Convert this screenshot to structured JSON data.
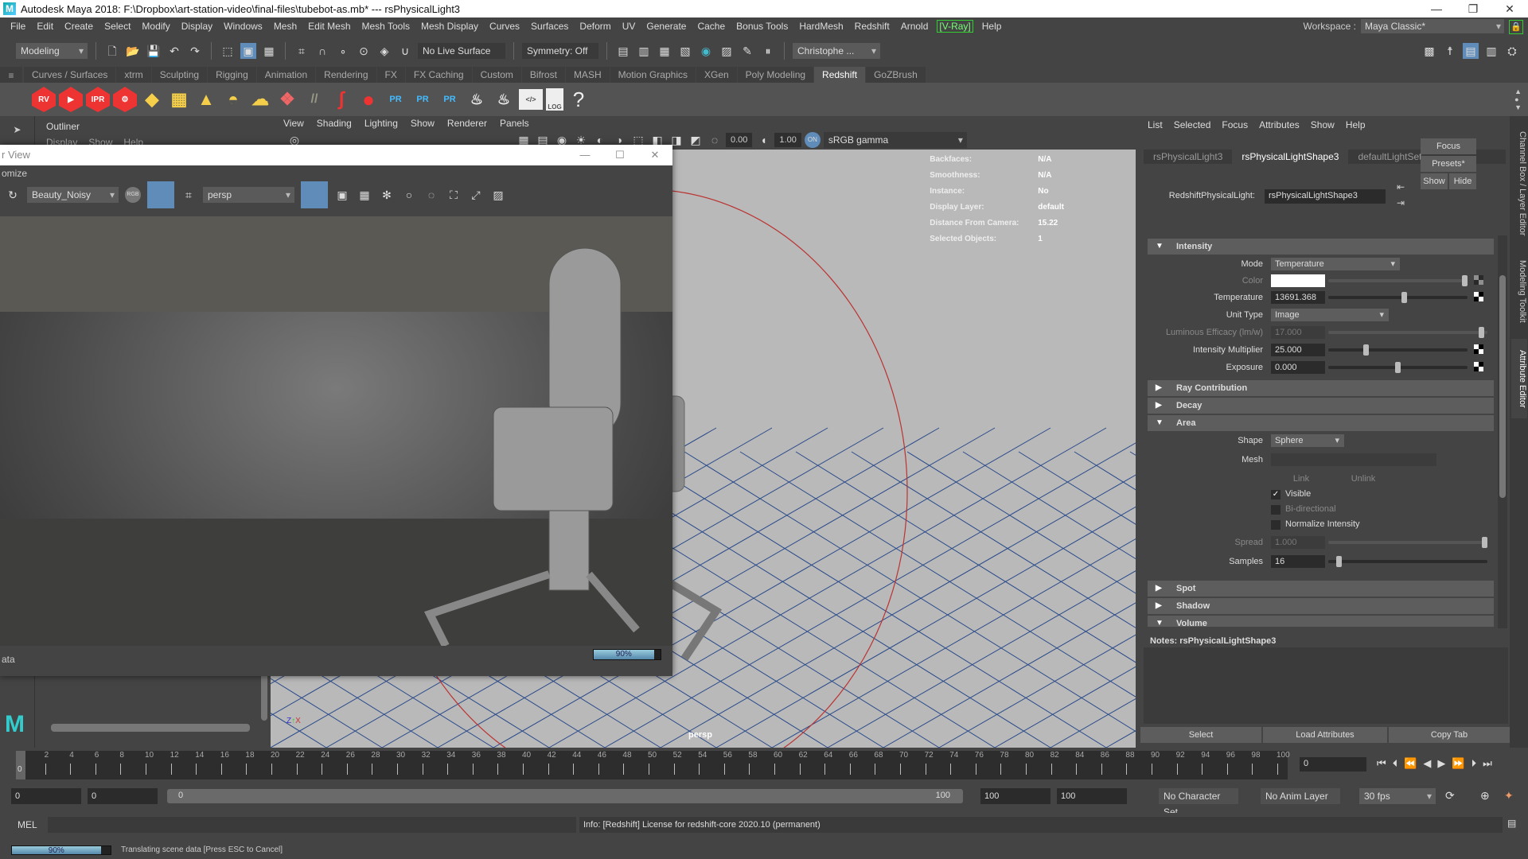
{
  "window": {
    "title": "Autodesk Maya 2018: F:\\Dropbox\\art-station-video\\final-files\\tubebot-as.mb*  ---  rsPhysicalLight3",
    "controls": [
      "—",
      "❐",
      "✕"
    ]
  },
  "menubar": [
    "File",
    "Edit",
    "Create",
    "Select",
    "Modify",
    "Display",
    "Windows",
    "Mesh",
    "Edit Mesh",
    "Mesh Tools",
    "Mesh Display",
    "Curves",
    "Surfaces",
    "Deform",
    "UV",
    "Generate",
    "Cache",
    "Bonus Tools",
    "HardMesh",
    "Redshift",
    "Arnold",
    "[V-Ray]",
    "Help"
  ],
  "workspace": {
    "label": "Workspace :",
    "value": "Maya Classic*"
  },
  "statusline": {
    "mode": "Modeling",
    "live_surface": "No Live Surface",
    "symmetry": "Symmetry: Off",
    "user": "Christophe ..."
  },
  "shelf": {
    "tabs": [
      "Curves / Surfaces",
      "xtrm",
      "Sculpting",
      "Rigging",
      "Animation",
      "Rendering",
      "FX",
      "FX Caching",
      "Custom",
      "Bifrost",
      "MASH",
      "Motion Graphics",
      "XGen",
      "Poly Modeling",
      "Redshift",
      "GoZBrush"
    ],
    "active_tab": "Redshift",
    "icons": [
      {
        "name": "rs-render-view",
        "label": "RV"
      },
      {
        "name": "rs-batch-render",
        "label": "▶"
      },
      {
        "name": "rs-ipr",
        "label": "IPR"
      },
      {
        "name": "rs-render-settings",
        "label": "⚙"
      },
      {
        "name": "rs-light-types",
        "label": "◆"
      },
      {
        "name": "rs-portal-light",
        "label": "▦"
      },
      {
        "name": "rs-ies-light",
        "label": "▲"
      },
      {
        "name": "rs-dome-light",
        "label": "◓"
      },
      {
        "name": "rs-sun-sky",
        "label": "☁"
      },
      {
        "name": "rs-proxy",
        "label": "❖"
      },
      {
        "name": "rs-hair",
        "label": "//"
      },
      {
        "name": "rs-volume",
        "label": "∫"
      },
      {
        "name": "rs-sphere",
        "label": "●"
      },
      {
        "name": "rs-pr-export",
        "label": "PR"
      },
      {
        "name": "rs-pr-import",
        "label": "PR"
      },
      {
        "name": "rs-pr-swap",
        "label": "PR"
      },
      {
        "name": "rs-material-cook-1",
        "label": "♨"
      },
      {
        "name": "rs-material-cook-2",
        "label": "♨"
      },
      {
        "name": "rs-shader-editor",
        "label": "</>"
      },
      {
        "name": "rs-log",
        "label": "LOG"
      },
      {
        "name": "rs-help",
        "label": "?"
      }
    ]
  },
  "outliner": {
    "title": "Outliner",
    "menu": [
      "Display",
      "Show",
      "Help"
    ]
  },
  "render_view": {
    "title": "r View",
    "menu_fragment": "omize",
    "aov": "Beauty_Noisy",
    "camera": "persp",
    "footer_label": "ata",
    "progress_text": "90%",
    "progress": 0.9
  },
  "viewport": {
    "menu": [
      "View",
      "Shading",
      "Lighting",
      "Show",
      "Renderer",
      "Panels"
    ],
    "exposure": "0.00",
    "gamma": "1.00",
    "color_space": "sRGB gamma",
    "camera_label": "persp",
    "hud": [
      {
        "k": "Backfaces:",
        "v": "N/A"
      },
      {
        "k": "Smoothness:",
        "v": "N/A"
      },
      {
        "k": "Instance:",
        "v": "No"
      },
      {
        "k": "Display Layer:",
        "v": "default"
      },
      {
        "k": "Distance From Camera:",
        "v": "15.22"
      },
      {
        "k": "Selected Objects:",
        "v": "1"
      }
    ]
  },
  "attribute_editor": {
    "menu": [
      "List",
      "Selected",
      "Focus",
      "Attributes",
      "Show",
      "Help"
    ],
    "tabs": [
      "rsPhysicalLight3",
      "rsPhysicalLightShape3",
      "defaultLightSet"
    ],
    "active_tab": "rsPhysicalLightShape3",
    "node_type_label": "RedshiftPhysicalLight:",
    "node_name": "rsPhysicalLightShape3",
    "buttons": {
      "focus": "Focus",
      "presets": "Presets*",
      "show": "Show",
      "hide": "Hide"
    },
    "sections": {
      "intensity": "Intensity",
      "ray_contribution": "Ray Contribution",
      "decay": "Decay",
      "area": "Area",
      "spot": "Spot",
      "shadow": "Shadow",
      "volume": "Volume"
    },
    "intensity": {
      "mode_label": "Mode",
      "mode": "Temperature",
      "color_label": "Color",
      "color": "#ffffff",
      "temperature_label": "Temperature",
      "temperature": "13691.368",
      "temperature_slider": 0.55,
      "unit_type_label": "Unit Type",
      "unit_type": "Image",
      "efficacy_label": "Luminous Efficacy (lm/w)",
      "efficacy": "17.000",
      "efficacy_slider": 0.98,
      "multiplier_label": "Intensity Multiplier",
      "multiplier": "25.000",
      "multiplier_slider": 0.26,
      "exposure_label": "Exposure",
      "exposure": "0.000",
      "exposure_slider": 0.5
    },
    "area": {
      "shape_label": "Shape",
      "shape": "Sphere",
      "mesh_label": "Mesh",
      "mesh": "",
      "link": "Link",
      "unlink": "Unlink",
      "visible_label": "Visible",
      "visible": true,
      "bidirectional_label": "Bi-directional",
      "bidirectional": false,
      "normalize_label": "Normalize Intensity",
      "normalize": false,
      "spread_label": "Spread",
      "spread": "1.000",
      "spread_slider": 1.0,
      "samples_label": "Samples",
      "samples": "16",
      "samples_slider": 0.05
    },
    "notes_label": "Notes:  rsPhysicalLightShape3",
    "notes": "",
    "footer": {
      "select": "Select",
      "load": "Load Attributes",
      "copy": "Copy Tab"
    }
  },
  "side_tabs": [
    "Channel Box / Layer Editor",
    "Modeling Toolkit",
    "Attribute Editor"
  ],
  "timeline": {
    "ticks": [
      "0",
      "2",
      "4",
      "6",
      "8",
      "10",
      "12",
      "14",
      "16",
      "18",
      "20",
      "22",
      "24",
      "26",
      "28",
      "30",
      "32",
      "34",
      "36",
      "38",
      "40",
      "42",
      "44",
      "46",
      "48",
      "50",
      "52",
      "54",
      "56",
      "58",
      "60",
      "62",
      "64",
      "66",
      "68",
      "70",
      "72",
      "74",
      "76",
      "78",
      "80",
      "82",
      "84",
      "86",
      "88",
      "90",
      "92",
      "94",
      "96",
      "98",
      "100"
    ],
    "current_frame": "0",
    "current_frame_field": "0"
  },
  "range": {
    "start": "0",
    "playback_start": "0",
    "slider_start": "0",
    "slider_end": "100",
    "playback_end": "100",
    "end": "100",
    "character_set": "No Character Set",
    "anim_layer": "No Anim Layer",
    "fps": "30 fps"
  },
  "command_line": {
    "lang": "MEL",
    "value": "",
    "info": "Info:  [Redshift] License for redshift-core 2020.10 (permanent)"
  },
  "help_line": {
    "progress_text": "90%",
    "progress": 0.9,
    "message": "Translating scene data [Press ESC to Cancel]"
  }
}
